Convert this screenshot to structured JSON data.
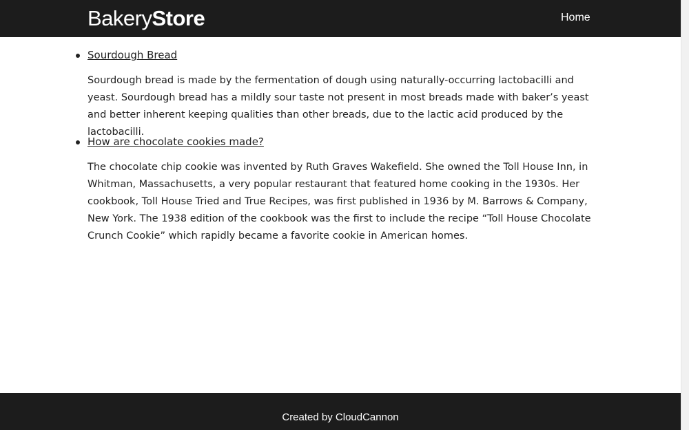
{
  "header": {
    "logo_light": "Bakery",
    "logo_bold": "Store",
    "nav": {
      "home": "Home"
    }
  },
  "articles": [
    {
      "title": "Sourdough Bread",
      "text": "Sourdough bread is made by the fermentation of dough using naturally-occurring lactobacilli and yeast. Sourdough bread has a mildly sour taste not present in most breads made with baker’s yeast and better inherent keeping qualities than other breads, due to the lactic acid produced by the lactobacilli."
    },
    {
      "title": "How are chocolate cookies made?",
      "text": "The chocolate chip cookie was invented by Ruth Graves Wakefield. She owned the Toll House Inn, in Whitman, Massachusetts, a very popular restaurant that featured home cooking in the 1930s. Her cookbook, Toll House Tried and True Recipes, was first published in 1936 by M. Barrows & Company, New York. The 1938 edition of the cookbook was the first to include the recipe “Toll House Chocolate Crunch Cookie” which rapidly became a favorite cookie in American homes."
    }
  ],
  "footer": {
    "text": "Created by CloudCannon"
  }
}
